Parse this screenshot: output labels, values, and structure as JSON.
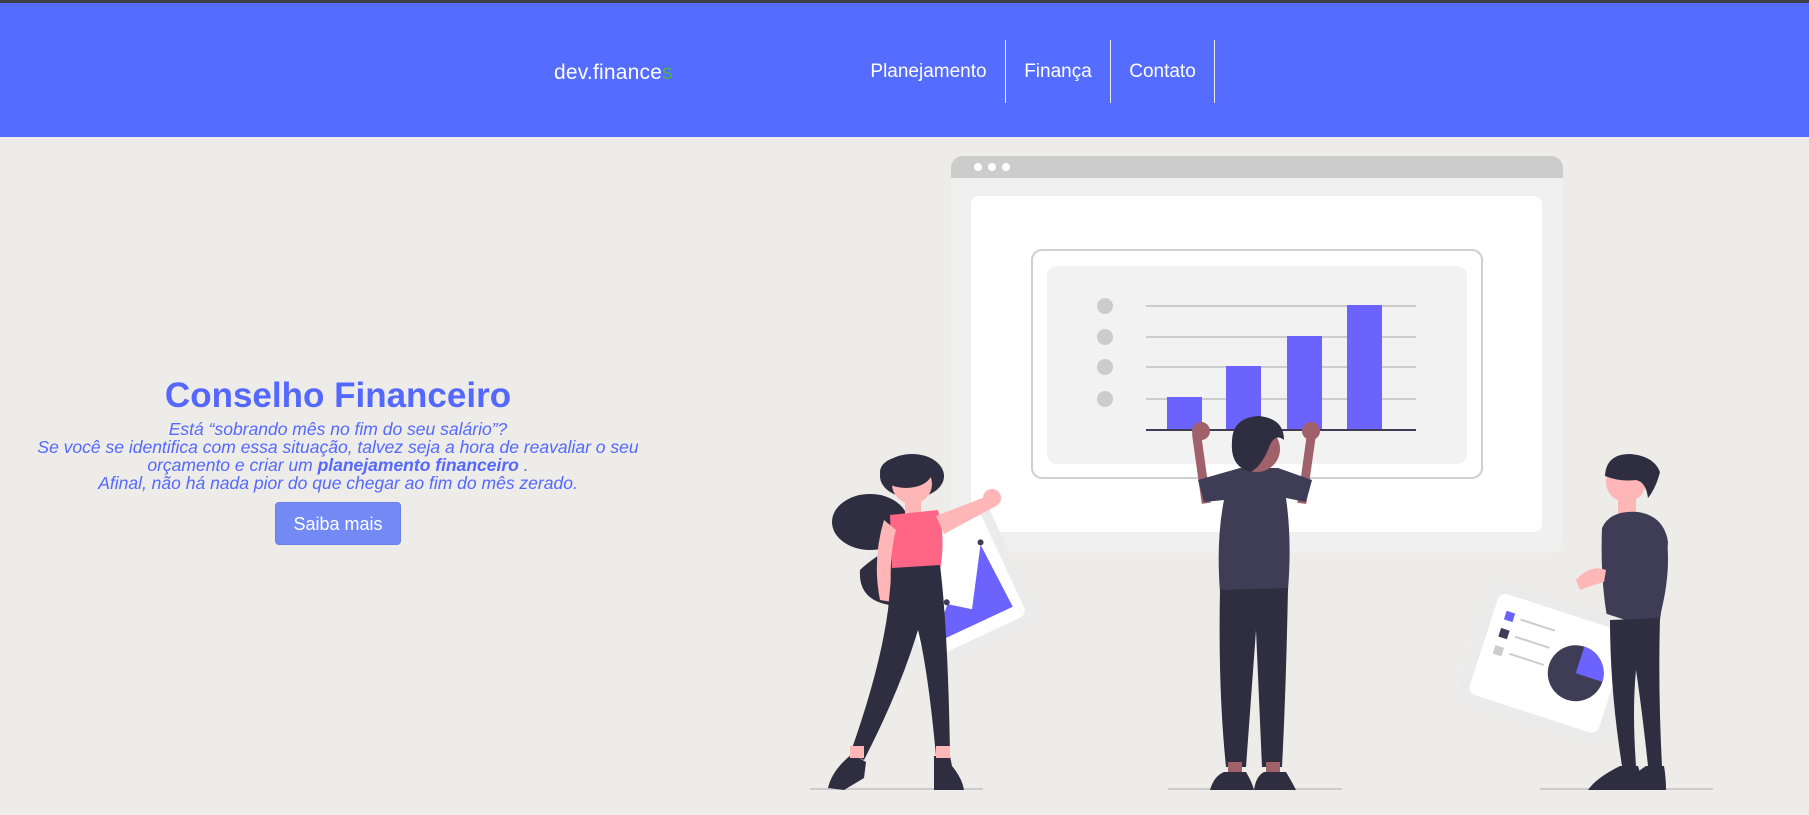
{
  "header": {
    "logo": {
      "part1": "dev",
      "part2": "finance",
      "accent": "s"
    },
    "nav": [
      {
        "label": "Planejamento"
      },
      {
        "label": "Finança"
      },
      {
        "label": "Contato"
      }
    ]
  },
  "hero": {
    "title": "Conselho Financeiro",
    "line1": "Está “sobrando mês no fim do seu salário”?",
    "line2_pre": "Se você se identifica com essa situação, talvez seja a hora de reavaliar o seu orçamento e criar um",
    "line2_bold": "planejamento financeiro",
    "line2_post": ".",
    "line3": "Afinal, não há nada pior do que chegar ao fim do mês zerado.",
    "button_label": "Saiba mais"
  },
  "colors": {
    "navbar": "#546cff",
    "background": "#edece8",
    "accent_green": "#4fae57",
    "button": "#7389f4",
    "chart_purple": "#6c63ff"
  },
  "illustration": {
    "icons": [
      "browser-window-icon",
      "bar-chart-icon",
      "person-icon",
      "pie-chart-icon"
    ]
  }
}
